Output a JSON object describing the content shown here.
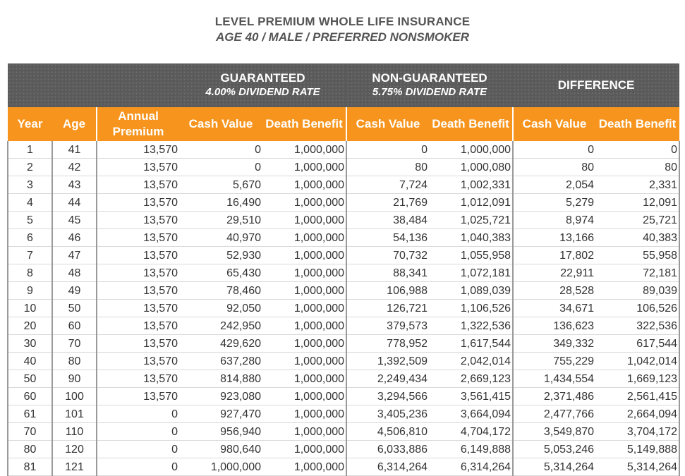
{
  "title": "LEVEL PREMIUM WHOLE LIFE INSURANCE",
  "subtitle": "AGE 40 / MALE / PREFERRED NONSMOKER",
  "groups": {
    "guaranteed": {
      "name": "GUARANTEED",
      "rate": "4.00% DIVIDEND RATE"
    },
    "non_guaranteed": {
      "name": "NON-GUARANTEED",
      "rate": "5.75% DIVIDEND RATE"
    },
    "difference": {
      "name": "DIFFERENCE"
    }
  },
  "columns": [
    "Year",
    "Age",
    "Annual Premium",
    "Cash Value",
    "Death Benefit",
    "Cash Value",
    "Death Benefit",
    "Cash Value",
    "Death Benefit"
  ],
  "rows": [
    [
      "1",
      "41",
      "13,570",
      "0",
      "1,000,000",
      "0",
      "1,000,000",
      "0",
      "0"
    ],
    [
      "2",
      "42",
      "13,570",
      "0",
      "1,000,000",
      "80",
      "1,000,080",
      "80",
      "80"
    ],
    [
      "3",
      "43",
      "13,570",
      "5,670",
      "1,000,000",
      "7,724",
      "1,002,331",
      "2,054",
      "2,331"
    ],
    [
      "4",
      "44",
      "13,570",
      "16,490",
      "1,000,000",
      "21,769",
      "1,012,091",
      "5,279",
      "12,091"
    ],
    [
      "5",
      "45",
      "13,570",
      "29,510",
      "1,000,000",
      "38,484",
      "1,025,721",
      "8,974",
      "25,721"
    ],
    [
      "6",
      "46",
      "13,570",
      "40,970",
      "1,000,000",
      "54,136",
      "1,040,383",
      "13,166",
      "40,383"
    ],
    [
      "7",
      "47",
      "13,570",
      "52,930",
      "1,000,000",
      "70,732",
      "1,055,958",
      "17,802",
      "55,958"
    ],
    [
      "8",
      "48",
      "13,570",
      "65,430",
      "1,000,000",
      "88,341",
      "1,072,181",
      "22,911",
      "72,181"
    ],
    [
      "9",
      "49",
      "13,570",
      "78,460",
      "1,000,000",
      "106,988",
      "1,089,039",
      "28,528",
      "89,039"
    ],
    [
      "10",
      "50",
      "13,570",
      "92,050",
      "1,000,000",
      "126,721",
      "1,106,526",
      "34,671",
      "106,526"
    ],
    [
      "20",
      "60",
      "13,570",
      "242,950",
      "1,000,000",
      "379,573",
      "1,322,536",
      "136,623",
      "322,536"
    ],
    [
      "30",
      "70",
      "13,570",
      "429,620",
      "1,000,000",
      "778,952",
      "1,617,544",
      "349,332",
      "617,544"
    ],
    [
      "40",
      "80",
      "13,570",
      "637,280",
      "1,000,000",
      "1,392,509",
      "2,042,014",
      "755,229",
      "1,042,014"
    ],
    [
      "50",
      "90",
      "13,570",
      "814,880",
      "1,000,000",
      "2,249,434",
      "2,669,123",
      "1,434,554",
      "1,669,123"
    ],
    [
      "60",
      "100",
      "13,570",
      "923,080",
      "1,000,000",
      "3,294,566",
      "3,561,415",
      "2,371,486",
      "2,561,415"
    ],
    [
      "61",
      "101",
      "0",
      "927,470",
      "1,000,000",
      "3,405,236",
      "3,664,094",
      "2,477,766",
      "2,664,094"
    ],
    [
      "70",
      "110",
      "0",
      "956,940",
      "1,000,000",
      "4,506,810",
      "4,704,172",
      "3,549,870",
      "3,704,172"
    ],
    [
      "80",
      "120",
      "0",
      "980,640",
      "1,000,000",
      "6,033,886",
      "6,149,888",
      "5,053,246",
      "5,149,888"
    ],
    [
      "81",
      "121",
      "0",
      "1,000,000",
      "1,000,000",
      "6,314,264",
      "6,314,264",
      "5,314,264",
      "5,314,264"
    ]
  ],
  "colors": {
    "header_dark": "#5a5a5a",
    "header_orange": "#f7941d",
    "text": "#333333",
    "title": "#555555"
  }
}
